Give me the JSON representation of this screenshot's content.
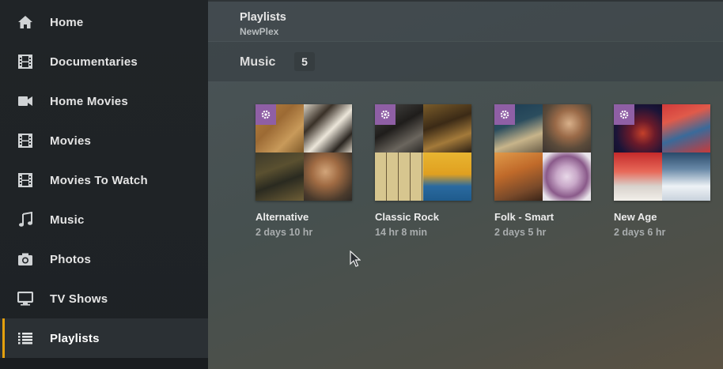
{
  "sidebar": {
    "items": [
      {
        "label": "Home",
        "icon": "home-icon"
      },
      {
        "label": "Documentaries",
        "icon": "film-icon"
      },
      {
        "label": "Home Movies",
        "icon": "video-camera-icon"
      },
      {
        "label": "Movies",
        "icon": "film-icon"
      },
      {
        "label": "Movies To Watch",
        "icon": "film-icon"
      },
      {
        "label": "Music",
        "icon": "music-note-icon"
      },
      {
        "label": "Photos",
        "icon": "camera-icon"
      },
      {
        "label": "TV Shows",
        "icon": "tv-icon"
      },
      {
        "label": "Playlists",
        "icon": "list-icon",
        "active": true
      }
    ]
  },
  "header": {
    "title": "Playlists",
    "subtitle": "NewPlex"
  },
  "section": {
    "title": "Music",
    "count": "5"
  },
  "playlists": [
    {
      "title": "Alternative",
      "duration": "2 days 10 hr",
      "badge_icon": "gear-icon"
    },
    {
      "title": "Classic Rock",
      "duration": "14 hr 8 min",
      "badge_icon": "gear-icon"
    },
    {
      "title": "Folk - Smart",
      "duration": "2 days 5 hr",
      "badge_icon": "gear-icon"
    },
    {
      "title": "New Age",
      "duration": "2 days 6 hr",
      "badge_icon": "gear-icon"
    }
  ],
  "colors": {
    "accent": "#e5a00d",
    "badge": "#8f5fa5",
    "sidebar_bg": "#202427"
  }
}
